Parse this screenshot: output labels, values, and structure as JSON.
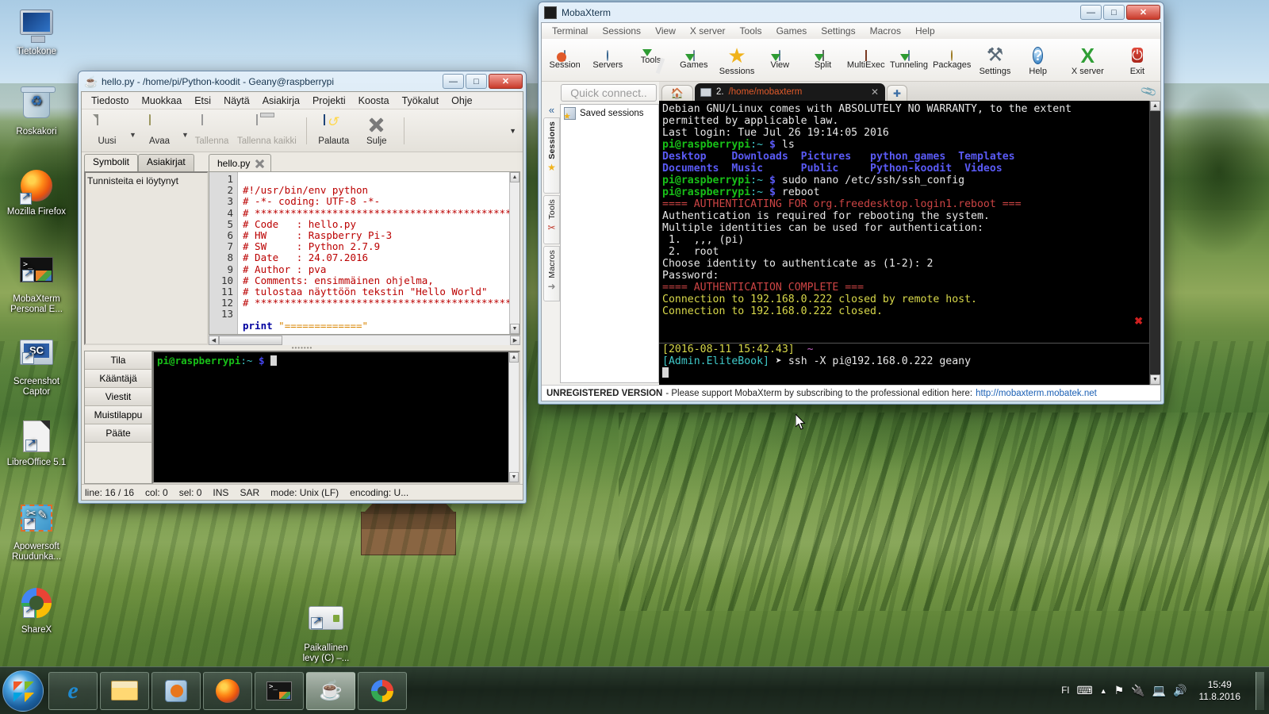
{
  "desktop": {
    "icons": [
      {
        "label": "Tietokone",
        "icon": "computer-icon"
      },
      {
        "label": "Roskakori",
        "icon": "recycle-bin-icon"
      },
      {
        "label": "Mozilla Firefox",
        "icon": "firefox-icon"
      },
      {
        "label": "MobaXterm Personal E...",
        "icon": "mobaxterm-icon"
      },
      {
        "label": "Screenshot Captor",
        "icon": "screenshot-captor-icon"
      },
      {
        "label": "LibreOffice 5.1",
        "icon": "libreoffice-icon"
      },
      {
        "label": "Apowersoft Ruudunka...",
        "icon": "apowersoft-icon"
      },
      {
        "label": "ShareX",
        "icon": "sharex-icon"
      }
    ],
    "drive_icon": {
      "label_line1": "Paikallinen",
      "label_line2": "levy (C) –...",
      "icon": "hard-drive-icon"
    }
  },
  "geany": {
    "title": "hello.py - /home/pi/Python-koodit - Geany@raspberrypi",
    "window_buttons": {
      "minimize": "—",
      "maximize": "□",
      "close": "✕"
    },
    "menu": [
      "Tiedosto",
      "Muokkaa",
      "Etsi",
      "Näytä",
      "Asiakirja",
      "Projekti",
      "Koosta",
      "Työkalut",
      "Ohje"
    ],
    "toolbar": [
      {
        "label": "Uusi",
        "icon": "new-file-icon",
        "disabled": false,
        "caret": true
      },
      {
        "label": "Avaa",
        "icon": "open-folder-icon",
        "disabled": false,
        "caret": true
      },
      {
        "label": "Tallenna",
        "icon": "save-icon",
        "disabled": true,
        "caret": false
      },
      {
        "label": "Tallenna kaikki",
        "icon": "save-all-icon",
        "disabled": true,
        "caret": false
      },
      {
        "label": "Palauta",
        "icon": "revert-icon",
        "disabled": false,
        "caret": false
      },
      {
        "label": "Sulje",
        "icon": "close-x-icon",
        "disabled": false,
        "caret": false
      }
    ],
    "toolbar_overflow": "▼",
    "side_tabs": [
      {
        "label": "Symbolit",
        "active": true
      },
      {
        "label": "Asiakirjat",
        "active": false
      }
    ],
    "symbols_empty_text": "Tunnisteita ei löytynyt",
    "editor_tab": {
      "label": "hello.py",
      "close_icon": "tab-close-icon"
    },
    "code_lines": [
      {
        "n": "1",
        "text": "#!/usr/bin/env python",
        "type": "comment"
      },
      {
        "n": "2",
        "text": "# -*- coding: UTF-8 -*-",
        "type": "comment"
      },
      {
        "n": "3",
        "text": "# ************************************************",
        "type": "comment"
      },
      {
        "n": "4",
        "text": "# Code   : hello.py",
        "type": "comment"
      },
      {
        "n": "5",
        "text": "# HW     : Raspberry Pi-3",
        "type": "comment"
      },
      {
        "n": "6",
        "text": "# SW     : Python 2.7.9",
        "type": "comment"
      },
      {
        "n": "7",
        "text": "# Date   : 24.07.2016",
        "type": "comment"
      },
      {
        "n": "8",
        "text": "# Author : pva",
        "type": "comment"
      },
      {
        "n": "9",
        "text": "# Comments: ensimmäinen ohjelma,",
        "type": "comment"
      },
      {
        "n": "10",
        "text": "# tulostaa näyttöön tekstin \"Hello World\"",
        "type": "comment"
      },
      {
        "n": "11",
        "text": "# ************************************************",
        "type": "comment"
      },
      {
        "n": "12",
        "text": "",
        "type": "plain"
      },
      {
        "n": "13",
        "text": "print \"=============\"",
        "type": "code",
        "kw": "print",
        "str": " \"=============\""
      }
    ],
    "message_tabs": [
      "Tila",
      "Kääntäjä",
      "Viestit",
      "Muistilappu",
      "Pääte"
    ],
    "terminal_prompt_user": "pi@raspberrypi",
    "terminal_prompt_path": ":~ ",
    "terminal_prompt_sign": "$",
    "statusbar": [
      "line: 16 / 16",
      "col: 0",
      "sel: 0",
      "INS",
      "SAR",
      "mode: Unix (LF)",
      "encoding: U..."
    ]
  },
  "mobaxterm": {
    "title": "MobaXterm",
    "window_buttons": {
      "minimize": "—",
      "maximize": "□",
      "close": "✕"
    },
    "menu": [
      "Terminal",
      "Sessions",
      "View",
      "X server",
      "Tools",
      "Games",
      "Settings",
      "Macros",
      "Help"
    ],
    "toolbar": [
      {
        "label": "Session",
        "icon": "session-icon"
      },
      {
        "label": "Servers",
        "icon": "servers-icon"
      },
      {
        "label": "Tools",
        "icon": "tools-icon"
      },
      {
        "label": "Games",
        "icon": "games-icon"
      },
      {
        "label": "Sessions",
        "icon": "sessions-star-icon"
      },
      {
        "label": "View",
        "icon": "view-icon"
      },
      {
        "label": "Split",
        "icon": "split-icon"
      },
      {
        "label": "MultiExec",
        "icon": "multiexec-icon"
      },
      {
        "label": "Tunneling",
        "icon": "tunneling-icon"
      },
      {
        "label": "Packages",
        "icon": "packages-icon"
      },
      {
        "label": "Settings",
        "icon": "settings-icon"
      },
      {
        "label": "Help",
        "icon": "help-icon"
      },
      {
        "label": "X server",
        "icon": "x-server-icon"
      },
      {
        "label": "Exit",
        "icon": "exit-icon"
      }
    ],
    "quick_connect": "Quick connect..",
    "collapse_icon": "«",
    "vertical_tabs": [
      {
        "label": "Sessions",
        "icon": "star-icon",
        "active": true
      },
      {
        "label": "Tools",
        "icon": "tools-icon",
        "active": false
      },
      {
        "label": "Macros",
        "icon": "macro-icon",
        "active": false
      }
    ],
    "saved_sessions_label": "Saved sessions",
    "tab": {
      "home_icon": "home-icon",
      "number": "2. ",
      "path": "/home/mobaxterm",
      "close_icon": "tab-close-icon",
      "plus_icon": "new-tab-icon",
      "clip_icon": "paperclip-icon"
    },
    "console_lines": [
      {
        "segments": [
          {
            "t": "Debian GNU/Linux comes with ABSOLUTELY NO WARRANTY, to the extent",
            "c": "white"
          }
        ]
      },
      {
        "segments": [
          {
            "t": "permitted by applicable law.",
            "c": "white"
          }
        ]
      },
      {
        "segments": [
          {
            "t": "Last login: Tue Jul 26 19:14:05 2016",
            "c": "white"
          }
        ]
      },
      {
        "segments": [
          {
            "t": "pi@raspberrypi",
            "c": "green"
          },
          {
            "t": ":~ ",
            "c": "cyan"
          },
          {
            "t": "$",
            "c": "blue"
          },
          {
            "t": " ls",
            "c": "white"
          }
        ]
      },
      {
        "segments": [
          {
            "t": "Desktop    Downloads  Pictures   python_games  Templates",
            "c": "blue"
          }
        ]
      },
      {
        "segments": [
          {
            "t": "Documents  Music      Public     Python-koodit  Videos",
            "c": "blue"
          }
        ]
      },
      {
        "segments": [
          {
            "t": "pi@raspberrypi",
            "c": "green"
          },
          {
            "t": ":~ ",
            "c": "cyan"
          },
          {
            "t": "$",
            "c": "blue"
          },
          {
            "t": " sudo nano /etc/ssh/ssh_config",
            "c": "white"
          }
        ]
      },
      {
        "segments": [
          {
            "t": "pi@raspberrypi",
            "c": "green"
          },
          {
            "t": ":~ ",
            "c": "cyan"
          },
          {
            "t": "$",
            "c": "blue"
          },
          {
            "t": " reboot",
            "c": "white"
          }
        ]
      },
      {
        "segments": [
          {
            "t": "==== AUTHENTICATING FOR org.freedesktop.login1.reboot ===",
            "c": "red"
          }
        ]
      },
      {
        "segments": [
          {
            "t": "Authentication is required for rebooting the system.",
            "c": "white"
          }
        ]
      },
      {
        "segments": [
          {
            "t": "Multiple identities can be used for authentication:",
            "c": "white"
          }
        ]
      },
      {
        "segments": [
          {
            "t": " 1.  ,,, (pi)",
            "c": "white"
          }
        ]
      },
      {
        "segments": [
          {
            "t": " 2.  root",
            "c": "white"
          }
        ]
      },
      {
        "segments": [
          {
            "t": "Choose identity to authenticate as (1-2): 2",
            "c": "white"
          }
        ]
      },
      {
        "segments": [
          {
            "t": "Password:",
            "c": "white"
          }
        ]
      },
      {
        "segments": [
          {
            "t": "==== AUTHENTICATION COMPLETE ===",
            "c": "red"
          }
        ]
      },
      {
        "segments": [
          {
            "t": "Connection to 192.168.0.222 closed by remote host.",
            "c": "yellow"
          }
        ]
      },
      {
        "segments": [
          {
            "t": "Connection to 192.168.0.222 closed.",
            "c": "yellow"
          }
        ]
      }
    ],
    "console_tail": [
      {
        "segments": [
          {
            "t": "[2016-08-11 15:42.43]",
            "c": "yellow"
          },
          {
            "t": "  ~",
            "c": "magenta"
          }
        ]
      },
      {
        "segments": [
          {
            "t": "[Admin.EliteBook]",
            "c": "cyan"
          },
          {
            "t": " ➤ ",
            "c": "white"
          },
          {
            "t": "ssh -X pi@192.168.0.222 geany",
            "c": "white"
          }
        ]
      }
    ],
    "status": {
      "unregistered": "UNREGISTERED VERSION",
      "message": "-  Please support MobaXterm by subscribing to the professional edition here:",
      "link": "http://mobaxterm.mobatek.net"
    }
  },
  "taskbar": {
    "start_label": "start-orb",
    "buttons": [
      {
        "icon": "internet-explorer-icon",
        "active": false
      },
      {
        "icon": "file-explorer-icon",
        "active": false
      },
      {
        "icon": "media-player-icon",
        "active": false
      },
      {
        "icon": "firefox-icon",
        "active": false
      },
      {
        "icon": "mobaxterm-icon",
        "active": false
      },
      {
        "icon": "geany-icon",
        "active": true
      },
      {
        "icon": "sharex-icon",
        "active": false
      }
    ],
    "tray": {
      "language": "FI",
      "icons": [
        "keyboard-icon",
        "show-hidden-icons-icon",
        "network-flag-icon",
        "usb-eject-icon",
        "network-icon",
        "volume-icon"
      ],
      "time": "15:49",
      "date": "11.8.2016"
    }
  },
  "colors": {
    "geany_comment": "#bb0000",
    "geany_keyword": "#00009f",
    "geany_string": "#d88400",
    "terminal_green": "#18c018",
    "terminal_blue": "#5a5af5",
    "terminal_red": "#cc4444",
    "terminal_yellow": "#d8d84a",
    "terminal_cyan": "#3fc9c9",
    "aero_titlebar": "#dceaf7",
    "close_button": "#c93a2a"
  }
}
